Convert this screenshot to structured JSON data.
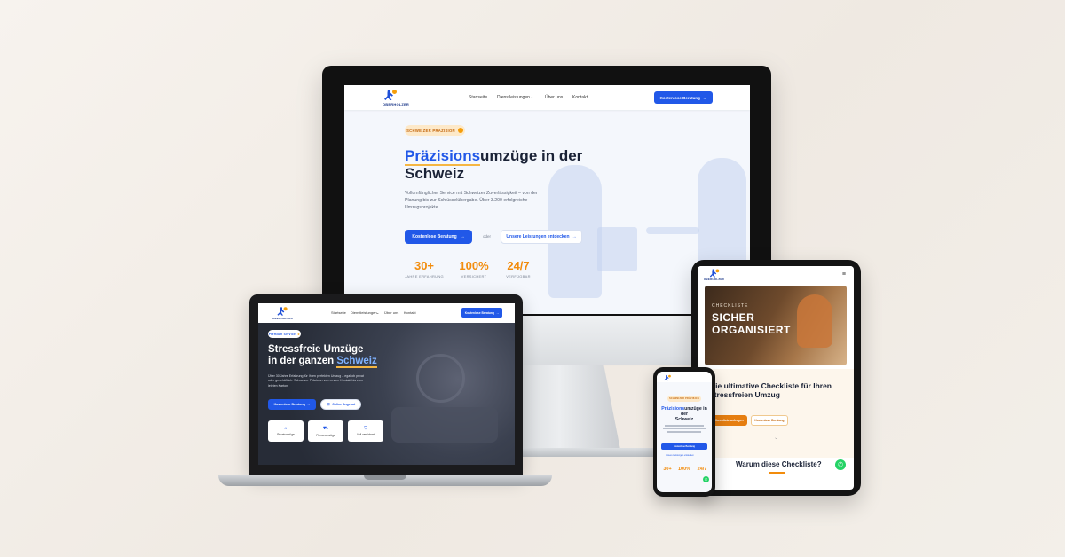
{
  "colors": {
    "brand_blue": "#2158e8",
    "accent_orange": "#f28c0c",
    "badge_bg": "#fde9c9",
    "dark_text": "#1a2236"
  },
  "logo": {
    "text": "OBERHOLZER"
  },
  "desktop": {
    "nav": {
      "links": [
        "Startseite",
        "Dienstleistungen",
        "Über uns",
        "Kontakt"
      ],
      "cta": "Kostenlose Beratung"
    },
    "badge": "SCHWEIZER PRÄZISION",
    "headline_accent": "Präzisions",
    "headline_rest_1": "umzüge in der",
    "headline_rest_2": "Schweiz",
    "sub_1": "Vollumfänglicher Service mit Schweizer Zuverlässigkeit – von der",
    "sub_2": "Planung bis zur Schlüsselübergabe. Über 3.200 erfolgreiche",
    "sub_3": "Umzugsprojekte.",
    "primary_cta": "Kostenlose Beratung",
    "or_text": "oder",
    "secondary_cta": "Unsere Leistungen entdecken",
    "stats": [
      {
        "value": "30+",
        "label": "JAHRE ERFAHRUNG"
      },
      {
        "value": "100%",
        "label": "VERSICHERT"
      },
      {
        "value": "24/7",
        "label": "VERFÜGBAR"
      }
    ]
  },
  "laptop": {
    "nav": {
      "links": [
        "Startseite",
        "Dienstleistungen",
        "Über uns",
        "Kontakt"
      ],
      "cta": "Kostenlose Beratung"
    },
    "badge": "Premium Service",
    "headline_1": "Stressfreie Umzüge",
    "headline_2_pre": "in der ganzen ",
    "headline_2_accent": "Schweiz",
    "sub_1": "Über 30 Jahre Erfahrung für Ihren perfekten Umzug – egal ob privat",
    "sub_2": "oder geschäftlich. Schweizer Präzision vom ersten Kontakt bis zum",
    "sub_3": "letzten Karton.",
    "primary_cta": "Kostenlose Beratung",
    "secondary_cta": "Online Angebot",
    "cards": [
      "Privatumzüge",
      "Firmenumzüge",
      "Voll versichert"
    ]
  },
  "tablet": {
    "image_text_1": "CHECKLISTE",
    "image_text_2": "SICHER",
    "image_text_3": "ORGANISIERT",
    "title_1": "Die ultimative Checkliste für Ihren",
    "title_2": "stressfreien Umzug",
    "primary_cta": "Checkliste anfragen",
    "secondary_cta": "Kostenlose Beratung",
    "section_title": "Warum diese Checkliste?"
  },
  "phone": {
    "badge": "SCHWEIZER PRÄZISION",
    "headline_accent": "Präzisions",
    "headline_rest": "umzüge in der",
    "headline_line2": "Schweiz",
    "primary_cta": "Kostenlose Beratung",
    "secondary_cta": "Unsere Leistungen entdecken",
    "stats": [
      "30+",
      "100%",
      "24/7"
    ]
  }
}
